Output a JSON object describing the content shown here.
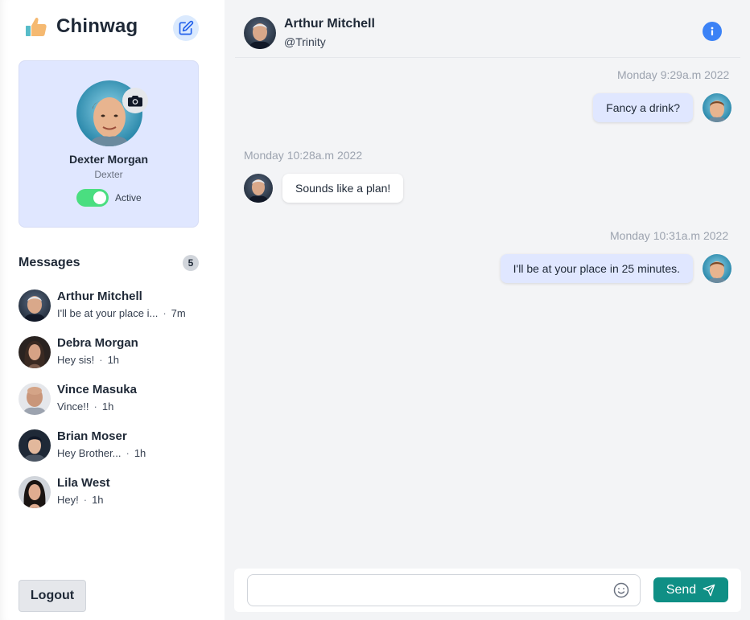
{
  "app": {
    "name": "Chinwag"
  },
  "profile": {
    "name": "Dexter Morgan",
    "handle": "Dexter",
    "status_label": "Active",
    "active": true
  },
  "messages_section": {
    "title": "Messages",
    "count": "5"
  },
  "conversations": [
    {
      "name": "Arthur Mitchell",
      "preview": "I'll be at your place i...",
      "time": "7m"
    },
    {
      "name": "Debra Morgan",
      "preview": "Hey sis!",
      "time": "1h"
    },
    {
      "name": "Vince Masuka",
      "preview": "Vince!!",
      "time": "1h"
    },
    {
      "name": "Brian Moser",
      "preview": "Hey Brother...",
      "time": "1h"
    },
    {
      "name": "Lila West",
      "preview": "Hey!",
      "time": "1h"
    }
  ],
  "logout_label": "Logout",
  "chat": {
    "name": "Arthur Mitchell",
    "handle": "@Trinity",
    "messages": [
      {
        "time": "Monday 9:29a.m 2022",
        "text": "Fancy a drink?",
        "direction": "out"
      },
      {
        "time": "Monday 10:28a.m 2022",
        "text": "Sounds like a plan!",
        "direction": "in"
      },
      {
        "time": "Monday 10:31a.m 2022",
        "text": "I'll be at your place in 25 minutes.",
        "direction": "out"
      }
    ]
  },
  "composer": {
    "value": "",
    "placeholder": "",
    "send_label": "Send"
  },
  "colors": {
    "accent": "#0f8f85",
    "own_bubble": "#e0e7ff",
    "toggle_on": "#4ade80",
    "info": "#3b82f6"
  }
}
